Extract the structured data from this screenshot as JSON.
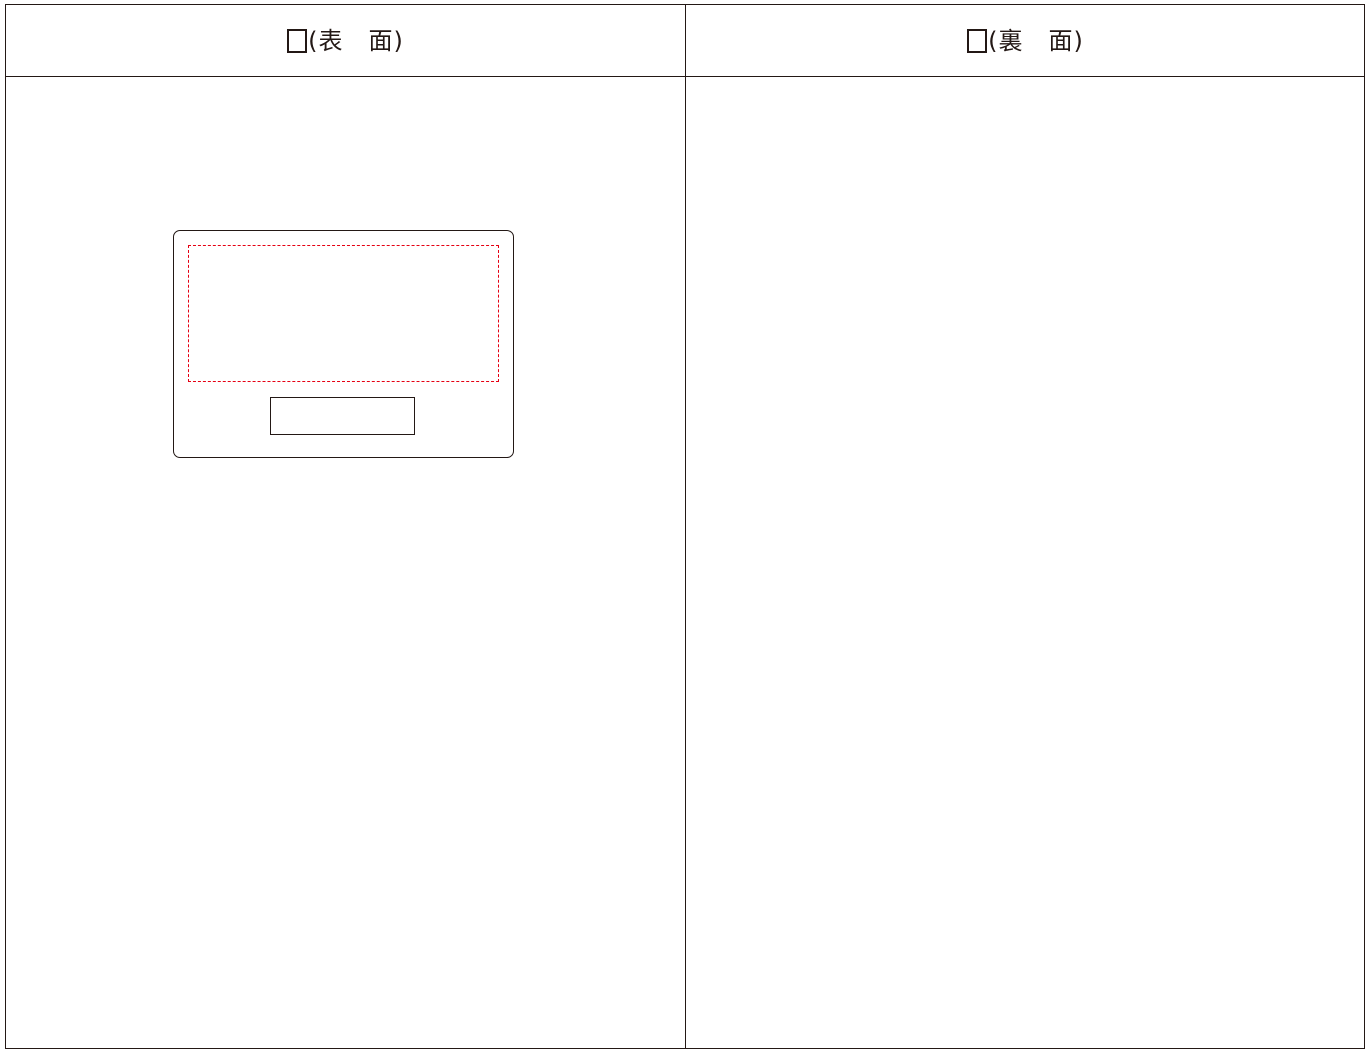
{
  "header": {
    "front": {
      "checkbox_icon": "empty-checkbox",
      "label": "(表　面)"
    },
    "back": {
      "checkbox_icon": "empty-checkbox",
      "label": "(裏　面)"
    }
  },
  "colors": {
    "line": "#231815",
    "dashed_area": "#e60012"
  }
}
